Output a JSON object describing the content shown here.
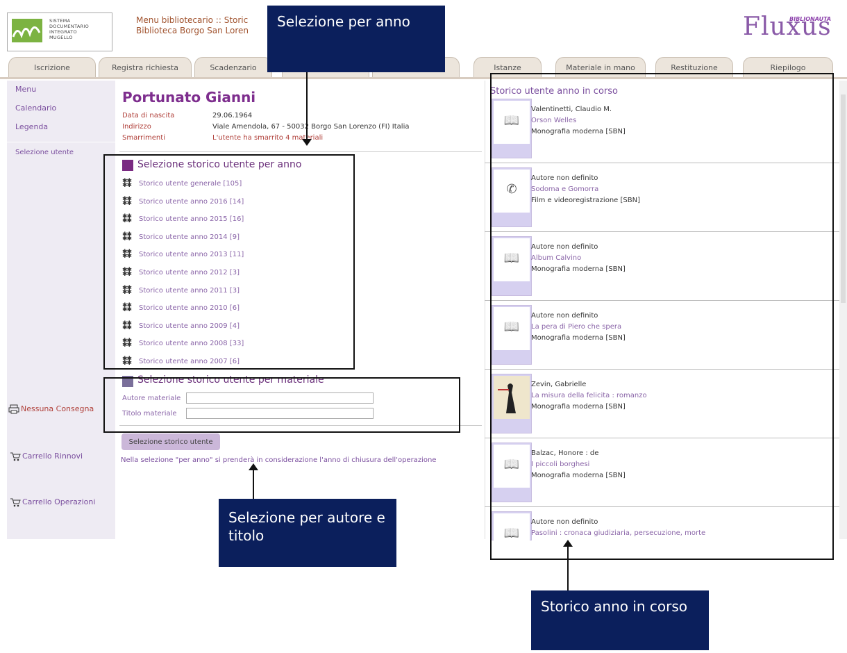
{
  "header": {
    "logo_lines": [
      "SISTEMA",
      "DOCUMENTARIO",
      "INTEGRATO",
      "MUGELLO"
    ],
    "breadcrumb_line1": "Menu bibliotecario :: Storic",
    "breadcrumb_line2": "Biblioteca Borgo San Loren",
    "brand_sub": "BIBLIONAUTA",
    "brand": "Fluxus"
  },
  "tabs": [
    "Iscrizione",
    "Registra richiesta",
    "Scadenzario",
    "Istanze",
    "Materiale in mano",
    "Restituzione",
    "Riepilogo"
  ],
  "left_menu": {
    "items": [
      "Menu",
      "Calendario",
      "Legenda"
    ],
    "selection": "Selezione utente",
    "buttons": [
      "Nessuna Consegna",
      "Carrello Rinnovi",
      "Carrello Operazioni"
    ]
  },
  "user": {
    "name": "Portunato Gianni",
    "birth_label": "Data di nascita",
    "birth": "29.06.1964",
    "address_label": "Indirizzo",
    "address": "Viale Amendola, 67 - 50032 Borgo San Lorenzo (FI) Italia",
    "lost_label": "Smarrimenti",
    "lost": "L'utente ha smarrito 4 materiali"
  },
  "year_section": {
    "title": "Selezione storico utente per anno",
    "items": [
      "Storico utente generale [105]",
      "Storico utente anno 2016 [14]",
      "Storico utente anno 2015 [16]",
      "Storico utente anno 2014 [9]",
      "Storico utente anno 2013 [11]",
      "Storico utente anno 2012 [3]",
      "Storico utente anno 2011 [3]",
      "Storico utente anno 2010 [6]",
      "Storico utente anno 2009 [4]",
      "Storico utente anno 2008 [33]",
      "Storico utente anno 2007 [6]"
    ]
  },
  "material_section": {
    "title": "Selezione storico utente per materiale",
    "author_label": "Autore materiale",
    "title_label": "Titolo materiale",
    "author_value": "",
    "title_value": "",
    "button": "Selezione storico utente",
    "note": "Nella selezione \"per anno\" si prenderà in considerazione l'anno di chiusura dell'operazione"
  },
  "history": {
    "title": "Storico utente anno in corso",
    "items": [
      {
        "author": "Valentinetti, Claudio M.",
        "title": "Orson Welles",
        "type": "Monografia moderna [SBN]",
        "icon": "book-icon"
      },
      {
        "author": "Autore non definito",
        "title": "Sodoma e Gomorra",
        "type": "Film e videoregistrazione [SBN]",
        "icon": "film-camera-icon"
      },
      {
        "author": "Autore non definito",
        "title": "Album Calvino",
        "type": "Monografia moderna [SBN]",
        "icon": "book-icon"
      },
      {
        "author": "Autore non definito",
        "title": "La pera di Piero che spera",
        "type": "Monografia moderna [SBN]",
        "icon": "book-icon"
      },
      {
        "author": "Zevin, Gabrielle",
        "title": "La misura della felicita : romanzo",
        "type": "Monografia moderna [SBN]",
        "icon": "cover-image"
      },
      {
        "author": "Balzac, Honore : de",
        "title": "I piccoli borghesi",
        "type": "Monografia moderna [SBN]",
        "icon": "book-icon"
      },
      {
        "author": "Autore non definito",
        "title": "Pasolini : cronaca giudiziaria, persecuzione, morte",
        "type": "",
        "icon": "book-icon"
      }
    ]
  },
  "annotations": {
    "year": "Selezione per anno",
    "material": "Selezione per autore e titolo",
    "current": "Storico anno in corso"
  }
}
